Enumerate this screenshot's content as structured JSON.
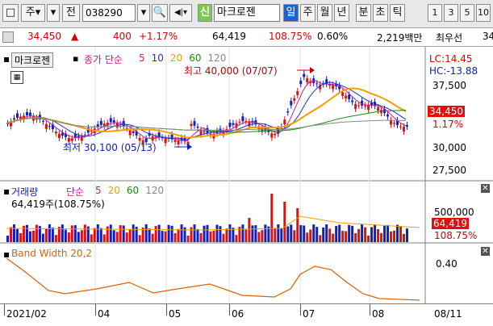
{
  "toolbar": {
    "type_label": "주",
    "mode_label": "전",
    "stock_code": "038290",
    "new_badge": "신",
    "stock_name": "마크로젠",
    "periods": [
      "일",
      "주",
      "월",
      "년",
      "분",
      "초",
      "틱"
    ],
    "active_period": "일",
    "intervals": [
      "1",
      "3",
      "5",
      "10"
    ]
  },
  "quote": {
    "price": "34,450",
    "change": "400",
    "change_pct": "+1.17%",
    "volume": "64,419",
    "volume_ratio": "108.75%",
    "turnover_rate": "0.60%",
    "amount": "2,219백만",
    "broker": "최우선",
    "broker_tail": "34"
  },
  "price_pane": {
    "name_tag": "마크로젠",
    "ma_label": "종가 단순",
    "ma_periods": [
      "5",
      "10",
      "20",
      "60",
      "120"
    ],
    "ma_colors": [
      "#d01890",
      "#1f2fd6",
      "#f0a000",
      "#109010",
      "#888888"
    ],
    "high_note": "최고 40,000 (07/07)",
    "low_note": "최저 30,100 (05/13)",
    "lc": "LC:14.45",
    "hc": "HC:-13.88",
    "y_ticks": [
      "37,500",
      "30,000",
      "27,500"
    ],
    "price_tag": "34,450",
    "pct_tag": "1.17%"
  },
  "volume_pane": {
    "title": "거래량",
    "ma_label": "단순",
    "ma_periods": [
      "5",
      "20",
      "60",
      "120"
    ],
    "value_text": "64,419주(108.75%)",
    "y_tick": "500,000",
    "vol_tag": "64,419",
    "pct_tag": "108.75%"
  },
  "bw_pane": {
    "title": "Band Width 20,2",
    "y_tick": "0.40"
  },
  "x_axis": {
    "ticks": [
      "2021/02",
      "04",
      "05",
      "06",
      "07",
      "08"
    ],
    "end_label": "08/11"
  }
}
